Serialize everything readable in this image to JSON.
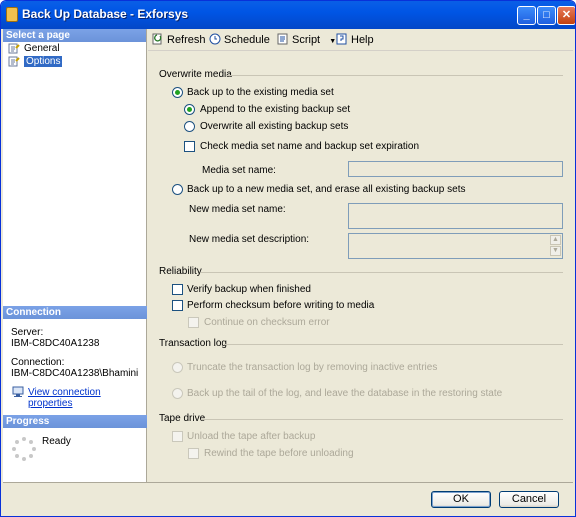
{
  "window": {
    "title": "Back Up Database - Exforsys",
    "minimize": "_",
    "maximize": "□",
    "close": "✕"
  },
  "sidebar": {
    "header": "Select a page",
    "items": [
      {
        "label": "General",
        "selected": false,
        "icon": "page-icon"
      },
      {
        "label": "Options",
        "selected": true,
        "icon": "page-icon"
      }
    ],
    "connection": {
      "header": "Connection",
      "server_label": "Server:",
      "server_value": "IBM-C8DC40A1238",
      "connection_label": "Connection:",
      "connection_value": "IBM-C8DC40A1238\\Bhamini",
      "view_link": "View connection properties"
    },
    "progress": {
      "header": "Progress",
      "status": "Ready"
    }
  },
  "toolbar": {
    "refresh": "Refresh",
    "schedule": "Schedule",
    "script": "Script",
    "help": "Help"
  },
  "overwrite_media": {
    "title": "Overwrite media",
    "backup_existing": "Back up to the existing media set",
    "append": "Append to the existing backup set",
    "overwrite_all": "Overwrite all existing backup sets",
    "check_media": "Check media set name and backup set expiration",
    "media_set_name": "Media set name:",
    "backup_new": "Back up to a new media set, and erase all existing backup sets",
    "new_media_set_name": "New media set name:",
    "new_media_set_description": "New media set description:"
  },
  "reliability": {
    "title": "Reliability",
    "verify": "Verify backup when finished",
    "checksum": "Perform checksum before writing to media",
    "continue_on_error": "Continue on checksum error"
  },
  "transaction_log": {
    "title": "Transaction log",
    "truncate": "Truncate the transaction log by removing inactive entries",
    "tail": "Back up the tail of the log, and leave the database in the restoring state"
  },
  "tape_drive": {
    "title": "Tape drive",
    "unload": "Unload the tape after backup",
    "rewind": "Rewind the tape before unloading"
  },
  "footer": {
    "ok": "OK",
    "cancel": "Cancel"
  }
}
